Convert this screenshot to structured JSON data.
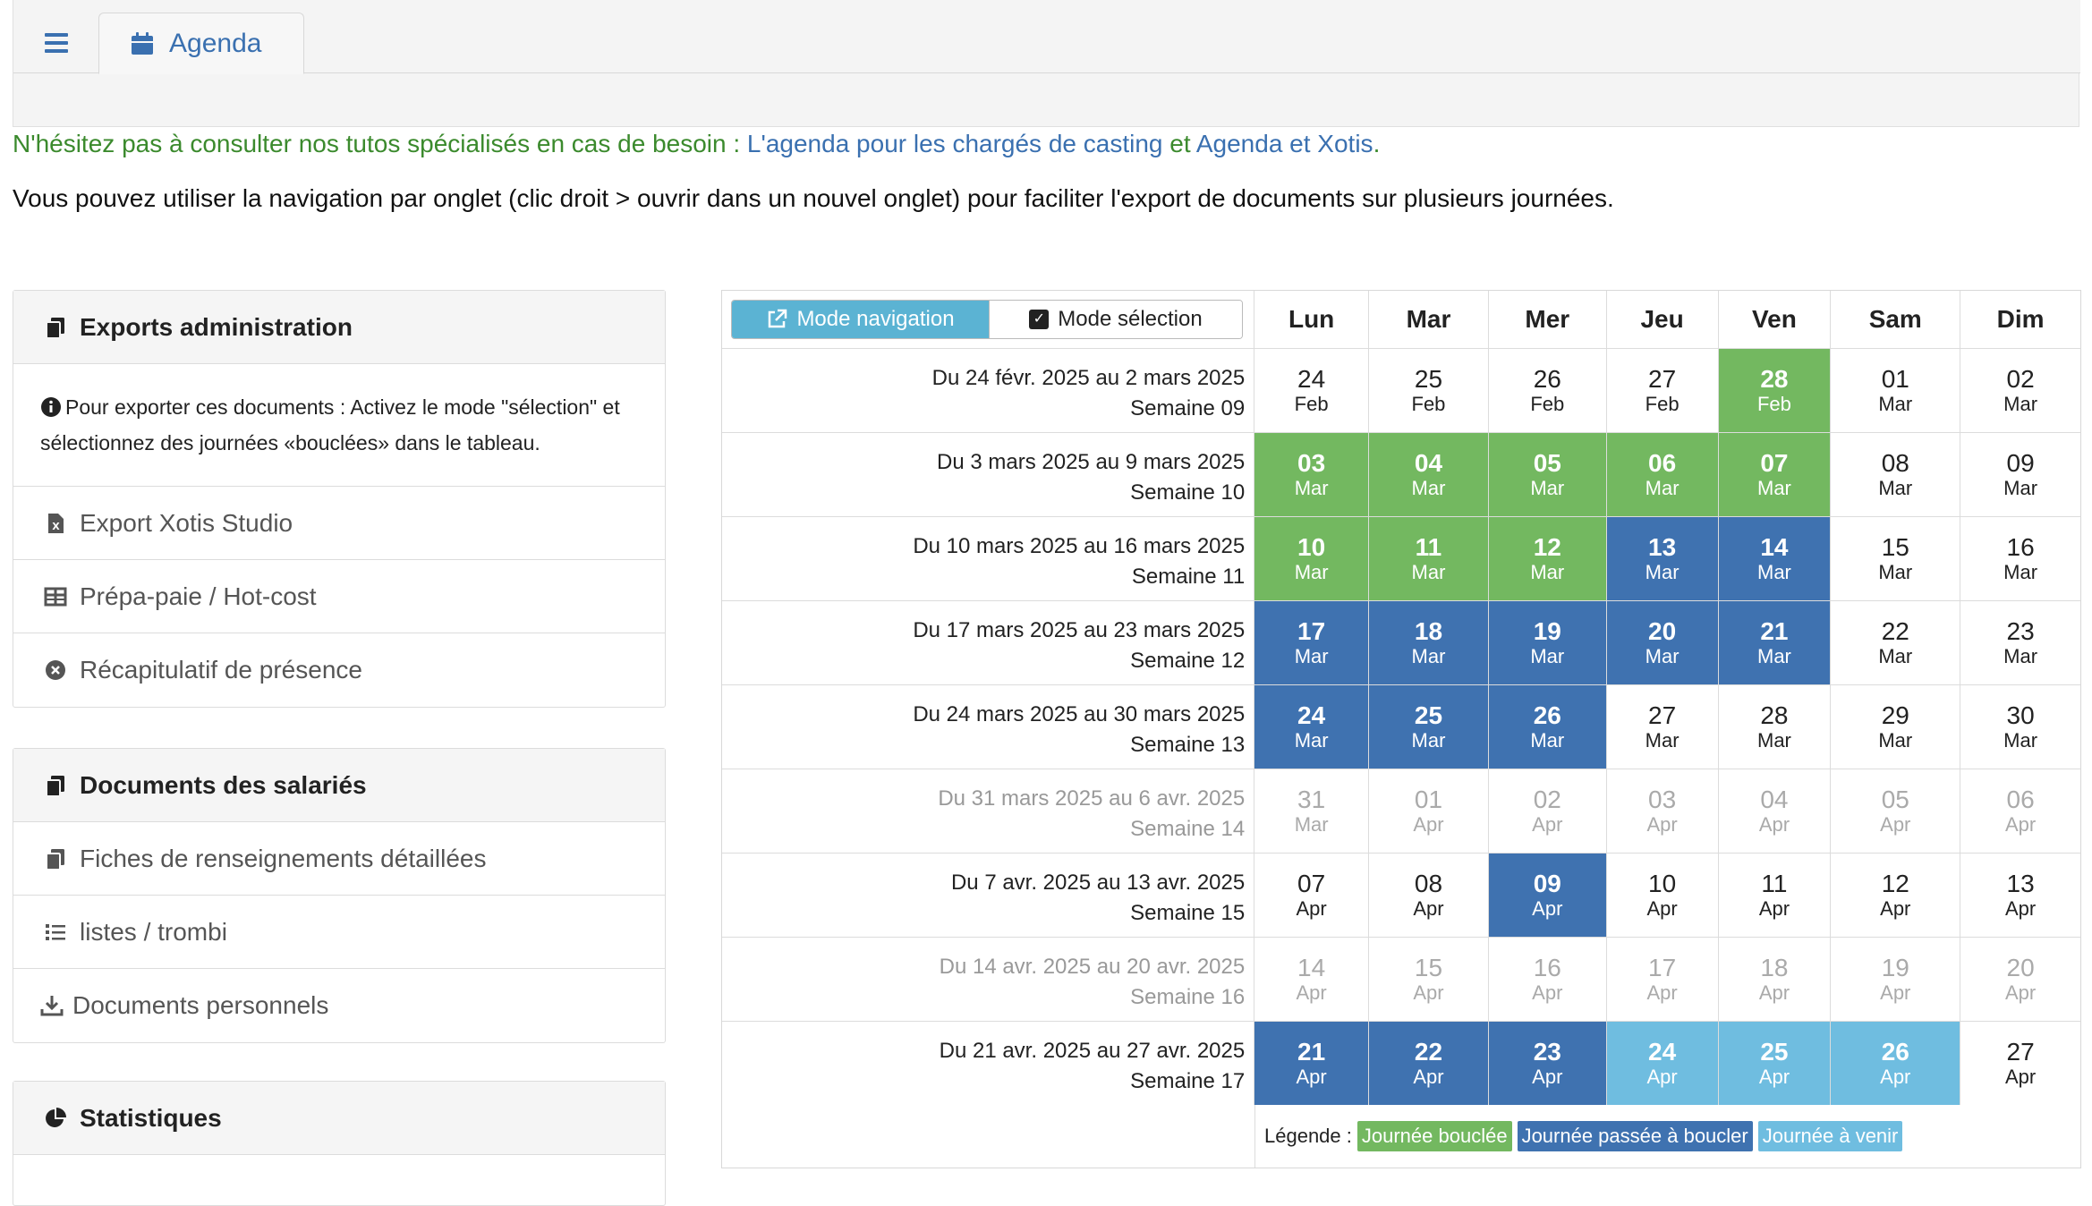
{
  "tabs": {
    "agenda_label": "Agenda"
  },
  "info": {
    "prefix": "N'hésitez pas à consulter nos tutos spécialisés en cas de besoin : ",
    "link1": "L'agenda pour les chargés de casting",
    "mid": " et ",
    "link2": "Agenda et Xotis",
    "suffix": ".",
    "navigation_hint": "Vous pouvez utiliser la navigation par onglet (clic droit > ouvrir dans un nouvel onglet) pour faciliter l'export de documents sur plusieurs journées."
  },
  "exports": {
    "title": "Exports administration",
    "help": "Pour exporter ces documents : Activez le mode \"sélection\" et sélectionnez des journées «bouclées» dans le tableau.",
    "items": [
      "Export Xotis Studio",
      "Prépa-paie / Hot-cost",
      "Récapitulatif de présence"
    ]
  },
  "documents": {
    "title": "Documents des salariés",
    "items": [
      "Fiches de renseignements détaillées",
      "listes / trombi",
      "Documents personnels"
    ]
  },
  "stats": {
    "title": "Statistiques"
  },
  "calendar": {
    "mode_navigation": "Mode navigation",
    "mode_selection": "Mode sélection",
    "days": [
      "Lun",
      "Mar",
      "Mer",
      "Jeu",
      "Ven",
      "Sam",
      "Dim"
    ],
    "weeks": [
      {
        "range": "Du 24 févr. 2025 au 2 mars 2025",
        "label": "Semaine 09",
        "dim": false,
        "cells": [
          [
            "24",
            "Feb",
            ""
          ],
          [
            "25",
            "Feb",
            ""
          ],
          [
            "26",
            "Feb",
            ""
          ],
          [
            "27",
            "Feb",
            ""
          ],
          [
            "28",
            "Feb",
            "green"
          ],
          [
            "01",
            "Mar",
            ""
          ],
          [
            "02",
            "Mar",
            ""
          ]
        ]
      },
      {
        "range": "Du 3 mars 2025 au 9 mars 2025",
        "label": "Semaine 10",
        "dim": false,
        "cells": [
          [
            "03",
            "Mar",
            "green"
          ],
          [
            "04",
            "Mar",
            "green"
          ],
          [
            "05",
            "Mar",
            "green"
          ],
          [
            "06",
            "Mar",
            "green"
          ],
          [
            "07",
            "Mar",
            "green"
          ],
          [
            "08",
            "Mar",
            ""
          ],
          [
            "09",
            "Mar",
            ""
          ]
        ]
      },
      {
        "range": "Du 10 mars 2025 au 16 mars 2025",
        "label": "Semaine 11",
        "dim": false,
        "cells": [
          [
            "10",
            "Mar",
            "green"
          ],
          [
            "11",
            "Mar",
            "green"
          ],
          [
            "12",
            "Mar",
            "green"
          ],
          [
            "13",
            "Mar",
            "blue"
          ],
          [
            "14",
            "Mar",
            "blue"
          ],
          [
            "15",
            "Mar",
            ""
          ],
          [
            "16",
            "Mar",
            ""
          ]
        ]
      },
      {
        "range": "Du 17 mars 2025 au 23 mars 2025",
        "label": "Semaine 12",
        "dim": false,
        "cells": [
          [
            "17",
            "Mar",
            "blue"
          ],
          [
            "18",
            "Mar",
            "blue"
          ],
          [
            "19",
            "Mar",
            "blue"
          ],
          [
            "20",
            "Mar",
            "blue"
          ],
          [
            "21",
            "Mar",
            "blue"
          ],
          [
            "22",
            "Mar",
            ""
          ],
          [
            "23",
            "Mar",
            ""
          ]
        ]
      },
      {
        "range": "Du 24 mars 2025 au 30 mars 2025",
        "label": "Semaine 13",
        "dim": false,
        "cells": [
          [
            "24",
            "Mar",
            "blue"
          ],
          [
            "25",
            "Mar",
            "blue"
          ],
          [
            "26",
            "Mar",
            "blue"
          ],
          [
            "27",
            "Mar",
            ""
          ],
          [
            "28",
            "Mar",
            ""
          ],
          [
            "29",
            "Mar",
            ""
          ],
          [
            "30",
            "Mar",
            ""
          ]
        ]
      },
      {
        "range": "Du 31 mars 2025 au 6 avr. 2025",
        "label": "Semaine 14",
        "dim": true,
        "cells": [
          [
            "31",
            "Mar",
            "dim"
          ],
          [
            "01",
            "Apr",
            "dim"
          ],
          [
            "02",
            "Apr",
            "dim"
          ],
          [
            "03",
            "Apr",
            "dim"
          ],
          [
            "04",
            "Apr",
            "dim"
          ],
          [
            "05",
            "Apr",
            "dim"
          ],
          [
            "06",
            "Apr",
            "dim"
          ]
        ]
      },
      {
        "range": "Du 7 avr. 2025 au 13 avr. 2025",
        "label": "Semaine 15",
        "dim": false,
        "cells": [
          [
            "07",
            "Apr",
            ""
          ],
          [
            "08",
            "Apr",
            ""
          ],
          [
            "09",
            "Apr",
            "blue"
          ],
          [
            "10",
            "Apr",
            ""
          ],
          [
            "11",
            "Apr",
            ""
          ],
          [
            "12",
            "Apr",
            ""
          ],
          [
            "13",
            "Apr",
            ""
          ]
        ]
      },
      {
        "range": "Du 14 avr. 2025 au 20 avr. 2025",
        "label": "Semaine 16",
        "dim": true,
        "cells": [
          [
            "14",
            "Apr",
            "dim"
          ],
          [
            "15",
            "Apr",
            "dim"
          ],
          [
            "16",
            "Apr",
            "dim"
          ],
          [
            "17",
            "Apr",
            "dim"
          ],
          [
            "18",
            "Apr",
            "dim"
          ],
          [
            "19",
            "Apr",
            "dim"
          ],
          [
            "20",
            "Apr",
            "dim"
          ]
        ]
      },
      {
        "range": "Du 21 avr. 2025 au 27 avr. 2025",
        "label": "Semaine 17",
        "dim": false,
        "cells": [
          [
            "21",
            "Apr",
            "blue"
          ],
          [
            "22",
            "Apr",
            "blue"
          ],
          [
            "23",
            "Apr",
            "blue"
          ],
          [
            "24",
            "Apr",
            "light"
          ],
          [
            "25",
            "Apr",
            "light"
          ],
          [
            "26",
            "Apr",
            "light"
          ],
          [
            "27",
            "Apr",
            ""
          ]
        ]
      }
    ],
    "legend": {
      "label": "Légende :",
      "items": [
        {
          "text": "Journée bouclée",
          "color": "#73b860"
        },
        {
          "text": "Journée passée à boucler",
          "color": "#3f72b0"
        },
        {
          "text": "Journée à venir",
          "color": "#6fbde0"
        }
      ]
    }
  }
}
